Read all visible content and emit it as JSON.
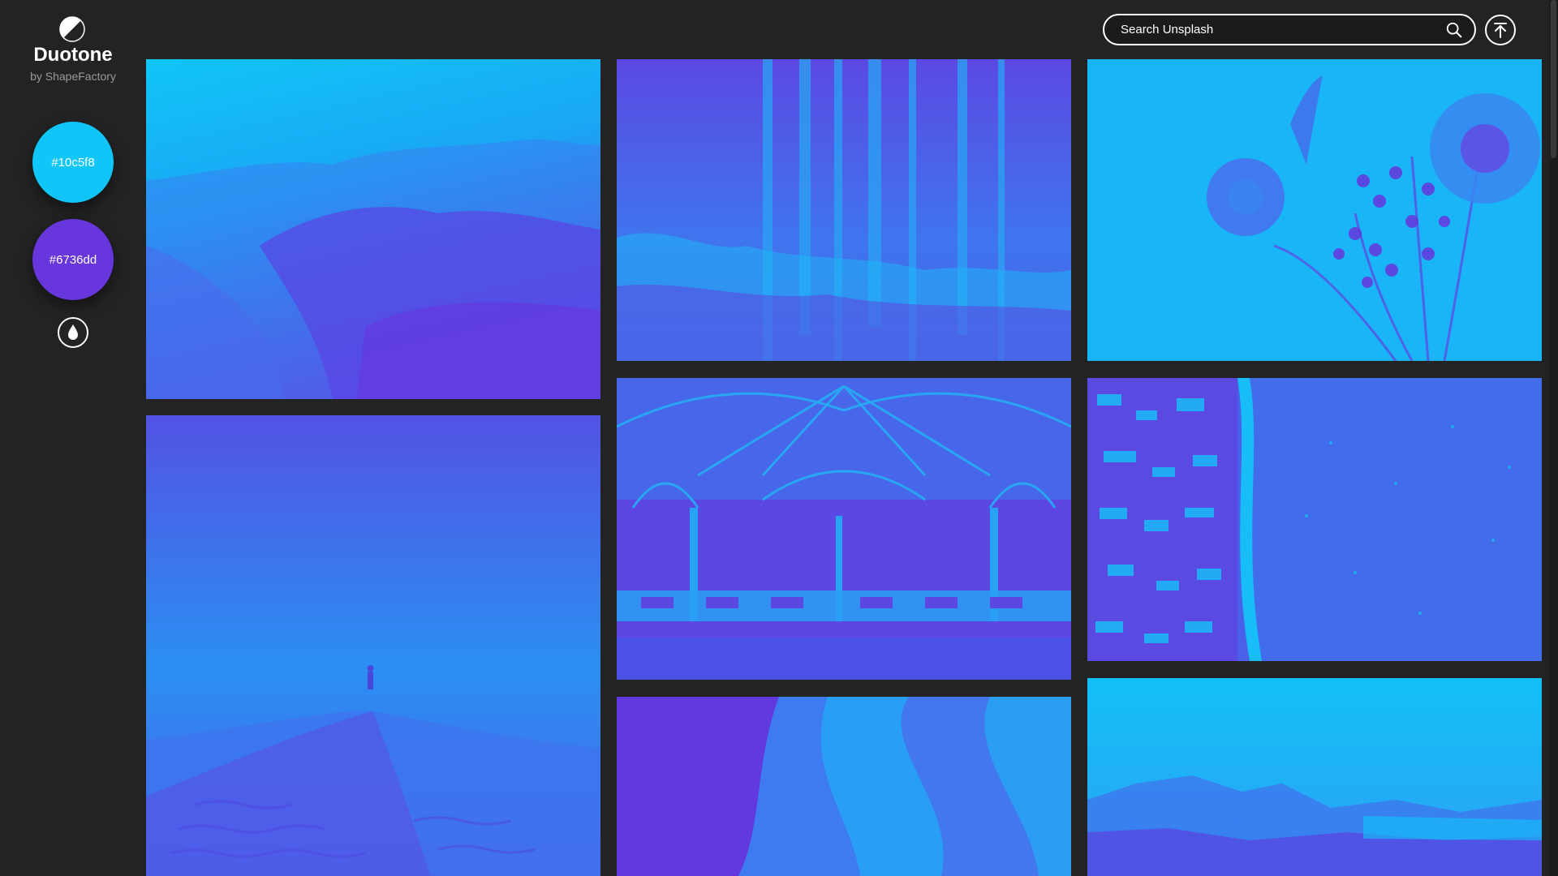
{
  "app": {
    "name": "Duotone",
    "byline": "by ShapeFactory"
  },
  "palette": {
    "primary": {
      "label": "#10c5f8",
      "color": "#10c5f8"
    },
    "secondary": {
      "label": "#6736dd",
      "color": "#6736dd"
    }
  },
  "icons": {
    "logo": "half-circle-icon",
    "drop": "water-drop-icon",
    "search": "search-icon",
    "back_to_top": "arrow-up-to-top-icon"
  },
  "search": {
    "placeholder": "Search Unsplash",
    "value": ""
  },
  "gallery": {
    "photos": [
      {
        "subject": "coastline-cliffs"
      },
      {
        "subject": "birch-forest"
      },
      {
        "subject": "flower-bouquet"
      },
      {
        "subject": "desert-dune-walker"
      },
      {
        "subject": "train-station-hall"
      },
      {
        "subject": "aerial-beach-town"
      },
      {
        "subject": "canyon-rock-waves"
      },
      {
        "subject": "mountain-lake"
      }
    ]
  }
}
